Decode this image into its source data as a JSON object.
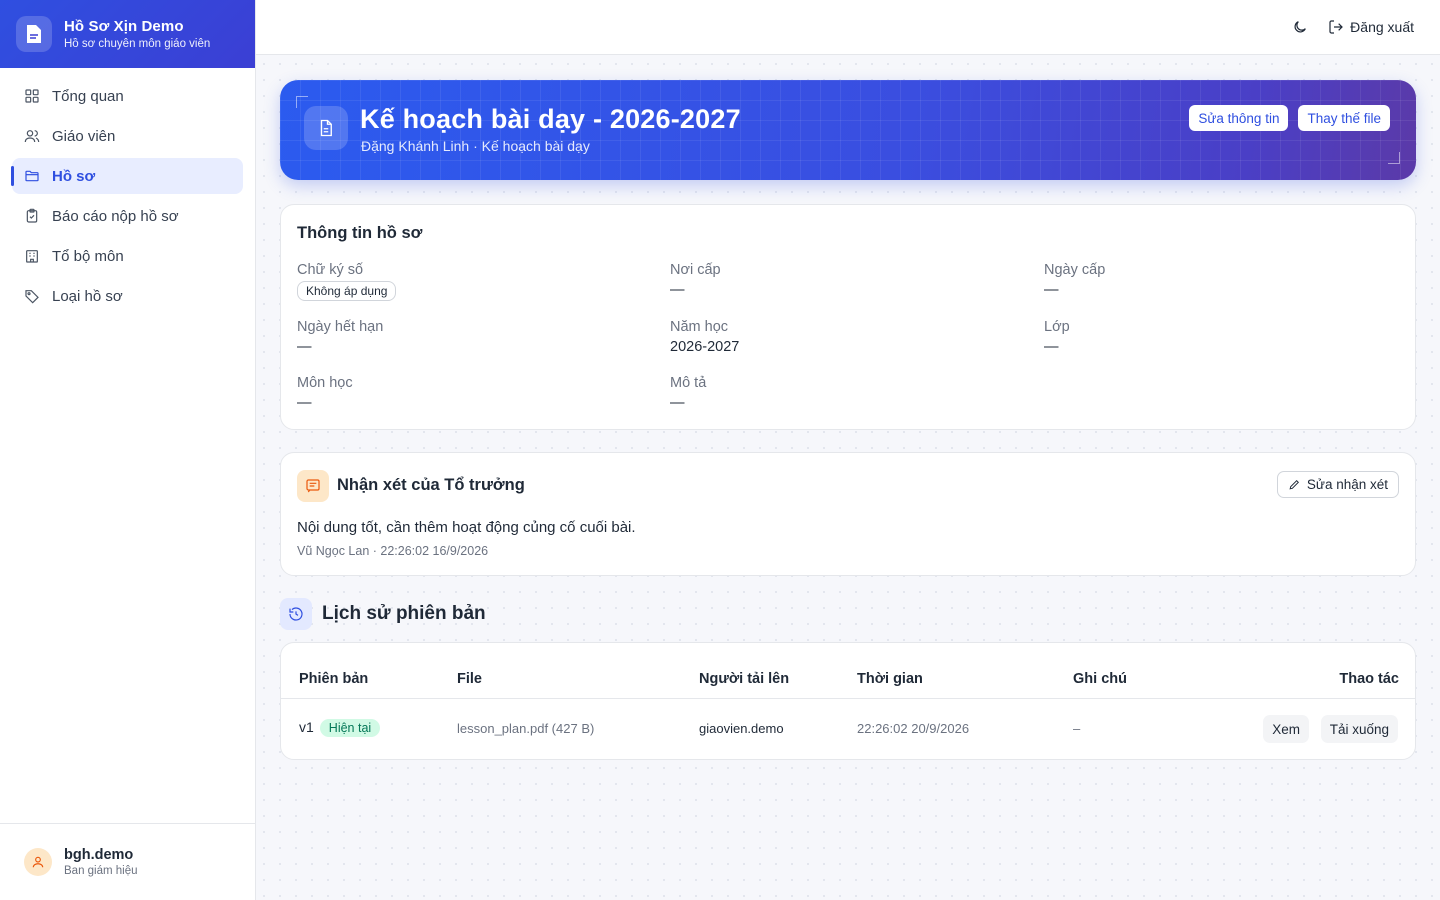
{
  "brand": {
    "title": "Hồ Sơ Xịn Demo",
    "subtitle": "Hồ sơ chuyên môn giáo viên"
  },
  "sidebar": {
    "items": [
      {
        "label": "Tổng quan",
        "icon": "grid-icon"
      },
      {
        "label": "Giáo viên",
        "icon": "users-icon"
      },
      {
        "label": "Hồ sơ",
        "icon": "folder-icon",
        "active": true
      },
      {
        "label": "Báo cáo nộp hồ sơ",
        "icon": "clipboard-check-icon"
      },
      {
        "label": "Tổ bộ môn",
        "icon": "building-icon"
      },
      {
        "label": "Loại hồ sơ",
        "icon": "tag-icon"
      }
    ],
    "user": {
      "name": "bgh.demo",
      "role": "Ban giám hiệu"
    }
  },
  "topbar": {
    "logout_label": "Đăng xuất"
  },
  "hero": {
    "title": "Kế hoạch bài dạy - 2026-2027",
    "subtitle": "Đặng Khánh Linh · Kế hoạch bài dạy",
    "edit_label": "Sửa thông tin",
    "replace_label": "Thay thế file"
  },
  "info": {
    "title": "Thông tin hồ sơ",
    "fields": [
      {
        "label": "Chữ ký số",
        "value": "Không áp dụng"
      },
      {
        "label": "Nơi cấp",
        "value": "—"
      },
      {
        "label": "Ngày cấp",
        "value": "—"
      },
      {
        "label": "Ngày hết hạn",
        "value": "—"
      },
      {
        "label": "Năm học",
        "value": "2026-2027"
      },
      {
        "label": "Lớp",
        "value": "—"
      },
      {
        "label": "Môn học",
        "value": "—"
      },
      {
        "label": "Mô tả",
        "value": "—"
      }
    ]
  },
  "comment": {
    "title": "Nhận xét của Tổ trưởng",
    "edit_label": "Sửa nhận xét",
    "text": "Nội dung tốt, cần thêm hoạt động củng cố cuối bài.",
    "meta": "Vũ Ngọc Lan · 22:26:02 16/9/2026"
  },
  "history": {
    "title": "Lịch sử phiên bản",
    "columns": [
      "Phiên bản",
      "File",
      "Người tải lên",
      "Thời gian",
      "Ghi chú",
      "Thao tác"
    ],
    "rows": [
      {
        "version": "v1",
        "badge": "Hiện tại",
        "file": "lesson_plan.pdf (427 B)",
        "uploader": "giaovien.demo",
        "time": "22:26:02 20/9/2026",
        "note": "–",
        "view_label": "Xem",
        "download_label": "Tải xuống"
      }
    ]
  }
}
